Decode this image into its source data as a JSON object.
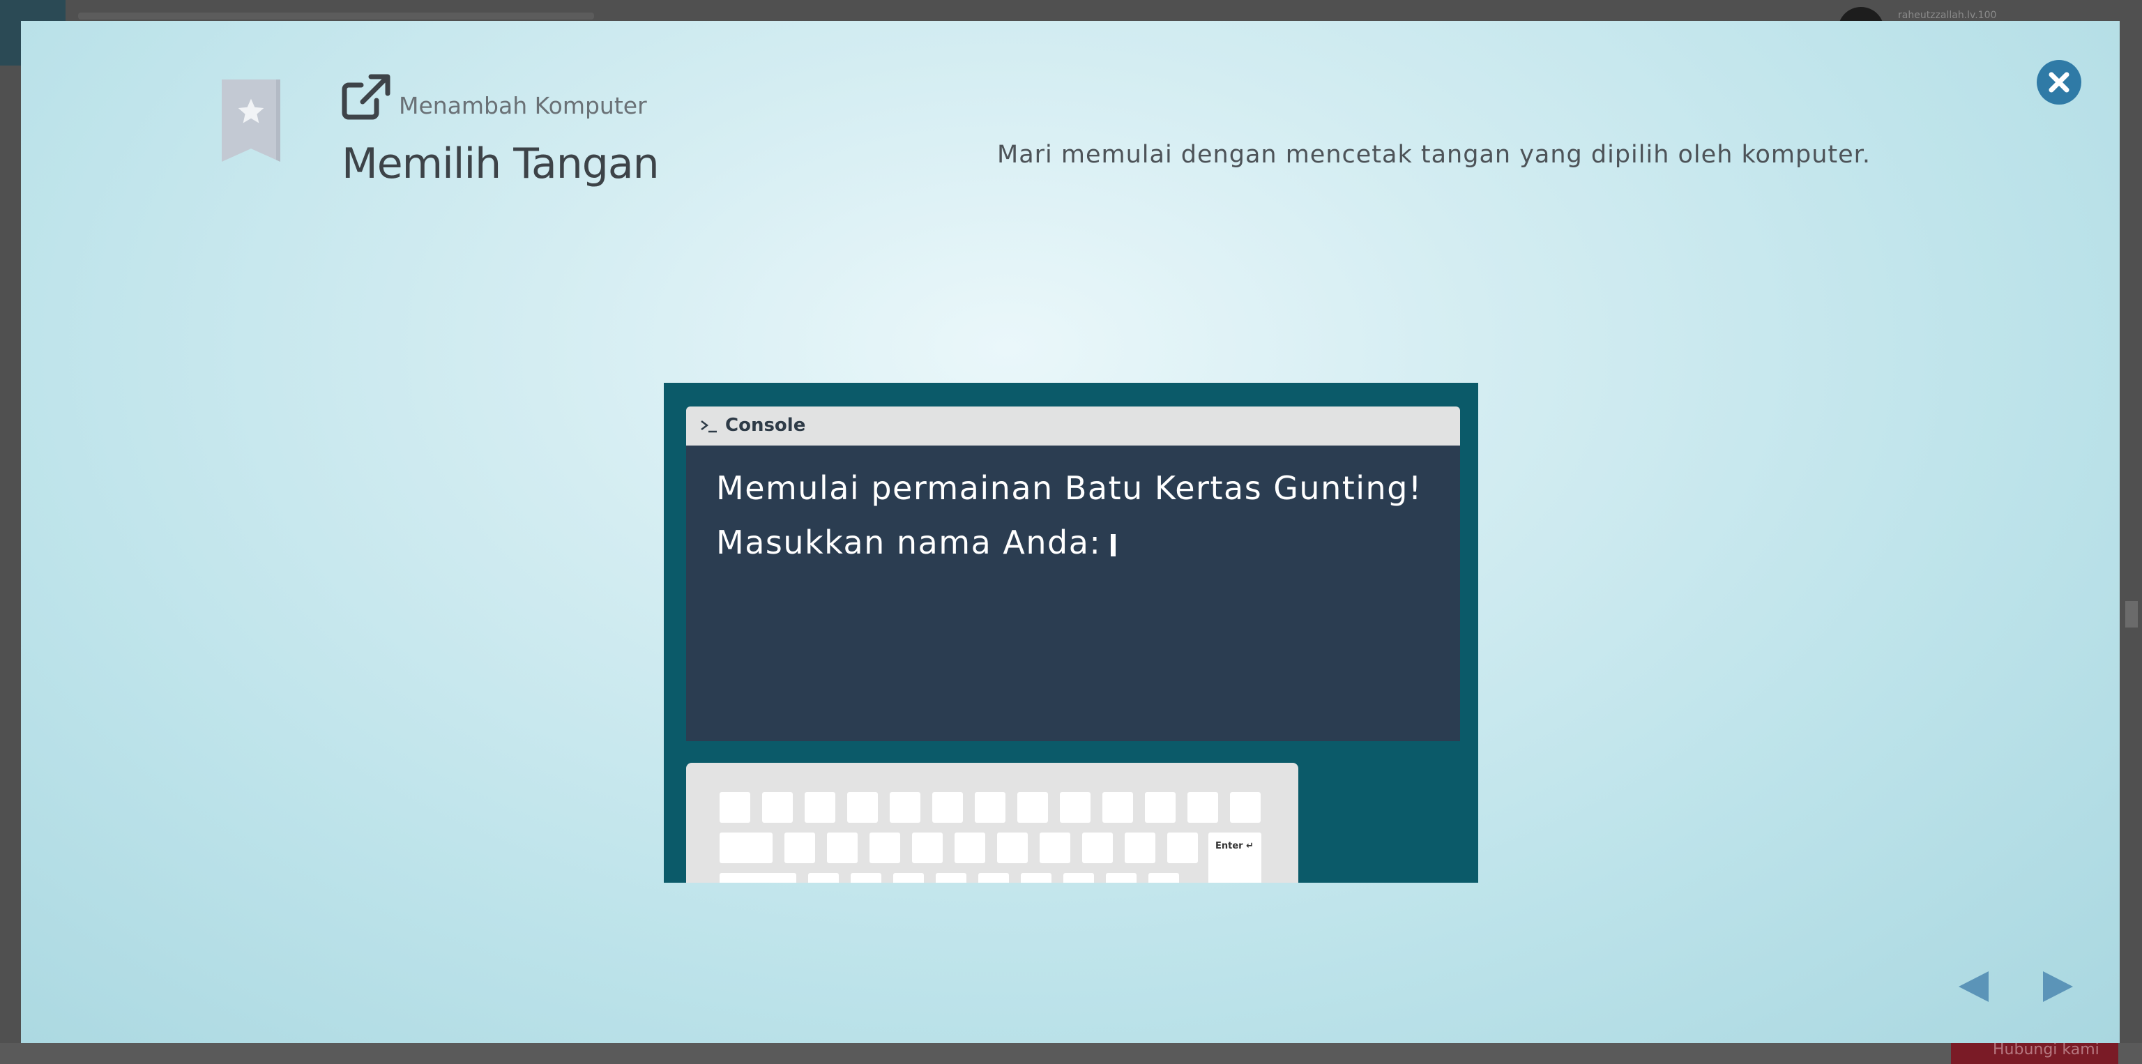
{
  "background": {
    "username": "raheutzzallah.lv.100",
    "bottom_button_label": "Hubungi kami"
  },
  "modal": {
    "breadcrumb": "Menambah Komputer",
    "title": "Memilih Tangan",
    "instruction": "Mari memulai dengan mencetak tangan yang dipilih oleh komputer.",
    "icons": {
      "bookmark": "bookmark-star-icon",
      "external": "external-link-icon",
      "close": "close-icon",
      "prev": "prev-arrow-icon",
      "next": "next-arrow-icon"
    },
    "colors": {
      "accent": "#2f7aa6",
      "arrow": "#5b94b8",
      "console_bg": "#2b3d51",
      "illustration_bg": "#0b5a69"
    }
  },
  "console": {
    "title": "Console",
    "line1": "Memulai permainan Batu Kertas Gunting!",
    "line2": "Masukkan nama Anda:",
    "enter_key": "Enter ↵"
  }
}
